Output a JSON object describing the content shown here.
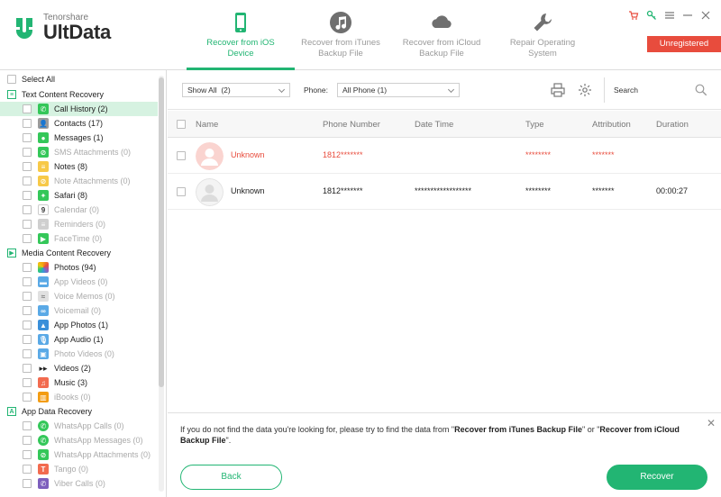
{
  "app": {
    "brand_small": "Tenorshare",
    "brand_big": "UltData",
    "unregistered": "Unregistered"
  },
  "colors": {
    "accent": "#22b573",
    "danger": "#e84c3d"
  },
  "nav": [
    {
      "line1": "Recover from iOS",
      "line2": "Device",
      "icon": "phone-icon",
      "active": true
    },
    {
      "line1": "Recover from iTunes",
      "line2": "Backup File",
      "icon": "music-icon",
      "active": false
    },
    {
      "line1": "Recover from iCloud",
      "line2": "Backup File",
      "icon": "cloud-icon",
      "active": false
    },
    {
      "line1": "Repair Operating",
      "line2": "System",
      "icon": "wrench-icon",
      "active": false
    }
  ],
  "sidebar": {
    "select_all": "Select All",
    "groups": [
      {
        "title": "Text Content Recovery",
        "items": [
          {
            "label": "Call History (2)",
            "icon": "phone-icon",
            "color": "#34c759",
            "selected": true,
            "disabled": false
          },
          {
            "label": "Contacts (17)",
            "icon": "contacts-icon",
            "color": "#9b9b9b",
            "disabled": false
          },
          {
            "label": "Messages (1)",
            "icon": "message-icon",
            "color": "#34c759",
            "disabled": false
          },
          {
            "label": "SMS Attachments (0)",
            "icon": "attachment-icon",
            "color": "#34c759",
            "disabled": true
          },
          {
            "label": "Notes (8)",
            "icon": "notes-icon",
            "color": "#f7c948",
            "disabled": false
          },
          {
            "label": "Note Attachments (0)",
            "icon": "attachment-icon",
            "color": "#f7c948",
            "disabled": true
          },
          {
            "label": "Safari (8)",
            "icon": "compass-icon",
            "color": "#34c759",
            "disabled": false
          },
          {
            "label": "Calendar (0)",
            "icon": "calendar-icon",
            "color": "#ffffff",
            "disabled": true
          },
          {
            "label": "Reminders (0)",
            "icon": "list-icon",
            "color": "#cfcfcf",
            "disabled": true
          },
          {
            "label": "FaceTime (0)",
            "icon": "video-icon",
            "color": "#34c759",
            "disabled": true
          }
        ]
      },
      {
        "title": "Media Content Recovery",
        "items": [
          {
            "label": "Photos (94)",
            "icon": "photos-icon",
            "color": "#f39c12",
            "disabled": false
          },
          {
            "label": "App Videos (0)",
            "icon": "video-icon",
            "color": "#5aa9e6",
            "disabled": true
          },
          {
            "label": "Voice Memos (0)",
            "icon": "waveform-icon",
            "color": "#cfcfcf",
            "disabled": true
          },
          {
            "label": "Voicemail (0)",
            "icon": "voicemail-icon",
            "color": "#5aa9e6",
            "disabled": true
          },
          {
            "label": "App Photos (1)",
            "icon": "image-icon",
            "color": "#3a8fd9",
            "disabled": false
          },
          {
            "label": "App Audio (1)",
            "icon": "mic-icon",
            "color": "#5aa9e6",
            "disabled": false
          },
          {
            "label": "Photo Videos (0)",
            "icon": "photo-video-icon",
            "color": "#5aa9e6",
            "disabled": true
          },
          {
            "label": "Videos (2)",
            "icon": "film-icon",
            "color": "#222222",
            "disabled": false
          },
          {
            "label": "Music (3)",
            "icon": "music-icon",
            "color": "#f26b4f",
            "disabled": false
          },
          {
            "label": "iBooks (0)",
            "icon": "book-icon",
            "color": "#f39c12",
            "disabled": true
          }
        ]
      },
      {
        "title": "App Data Recovery",
        "items": [
          {
            "label": "WhatsApp Calls (0)",
            "icon": "whatsapp-icon",
            "color": "#34c759",
            "disabled": true
          },
          {
            "label": "WhatsApp Messages (0)",
            "icon": "whatsapp-icon",
            "color": "#34c759",
            "disabled": true
          },
          {
            "label": "WhatsApp Attachments (0)",
            "icon": "attachment-icon",
            "color": "#34c759",
            "disabled": true
          },
          {
            "label": "Tango (0)",
            "icon": "tango-icon",
            "color": "#f26b4f",
            "disabled": true
          },
          {
            "label": "Viber Calls (0)",
            "icon": "viber-icon",
            "color": "#7d5fbd",
            "disabled": true
          }
        ]
      }
    ]
  },
  "toolbar": {
    "filter_value": "Show All  (2)",
    "phone_label": "Phone:",
    "phone_value": "All Phone (1)",
    "search_label": "Search"
  },
  "table": {
    "columns": [
      "Name",
      "Phone Number",
      "Date Time",
      "Type",
      "Attribution",
      "Duration"
    ],
    "rows": [
      {
        "name": "Unknown",
        "phone": "1812*******",
        "datetime": "",
        "type": "********",
        "attribution": "*******",
        "duration": "",
        "deleted": true
      },
      {
        "name": "Unknown",
        "phone": "1812*******",
        "datetime": "******************",
        "type": "********",
        "attribution": "*******",
        "duration": "00:00:27",
        "deleted": false
      }
    ]
  },
  "notice": {
    "prefix": "If you do not find the data you're looking for, please try to find the data from ",
    "link1": "Recover from iTunes Backup File",
    "middle": " or ",
    "link2": "Recover from iCloud Backup File",
    "suffix": "."
  },
  "buttons": {
    "back": "Back",
    "recover": "Recover"
  }
}
